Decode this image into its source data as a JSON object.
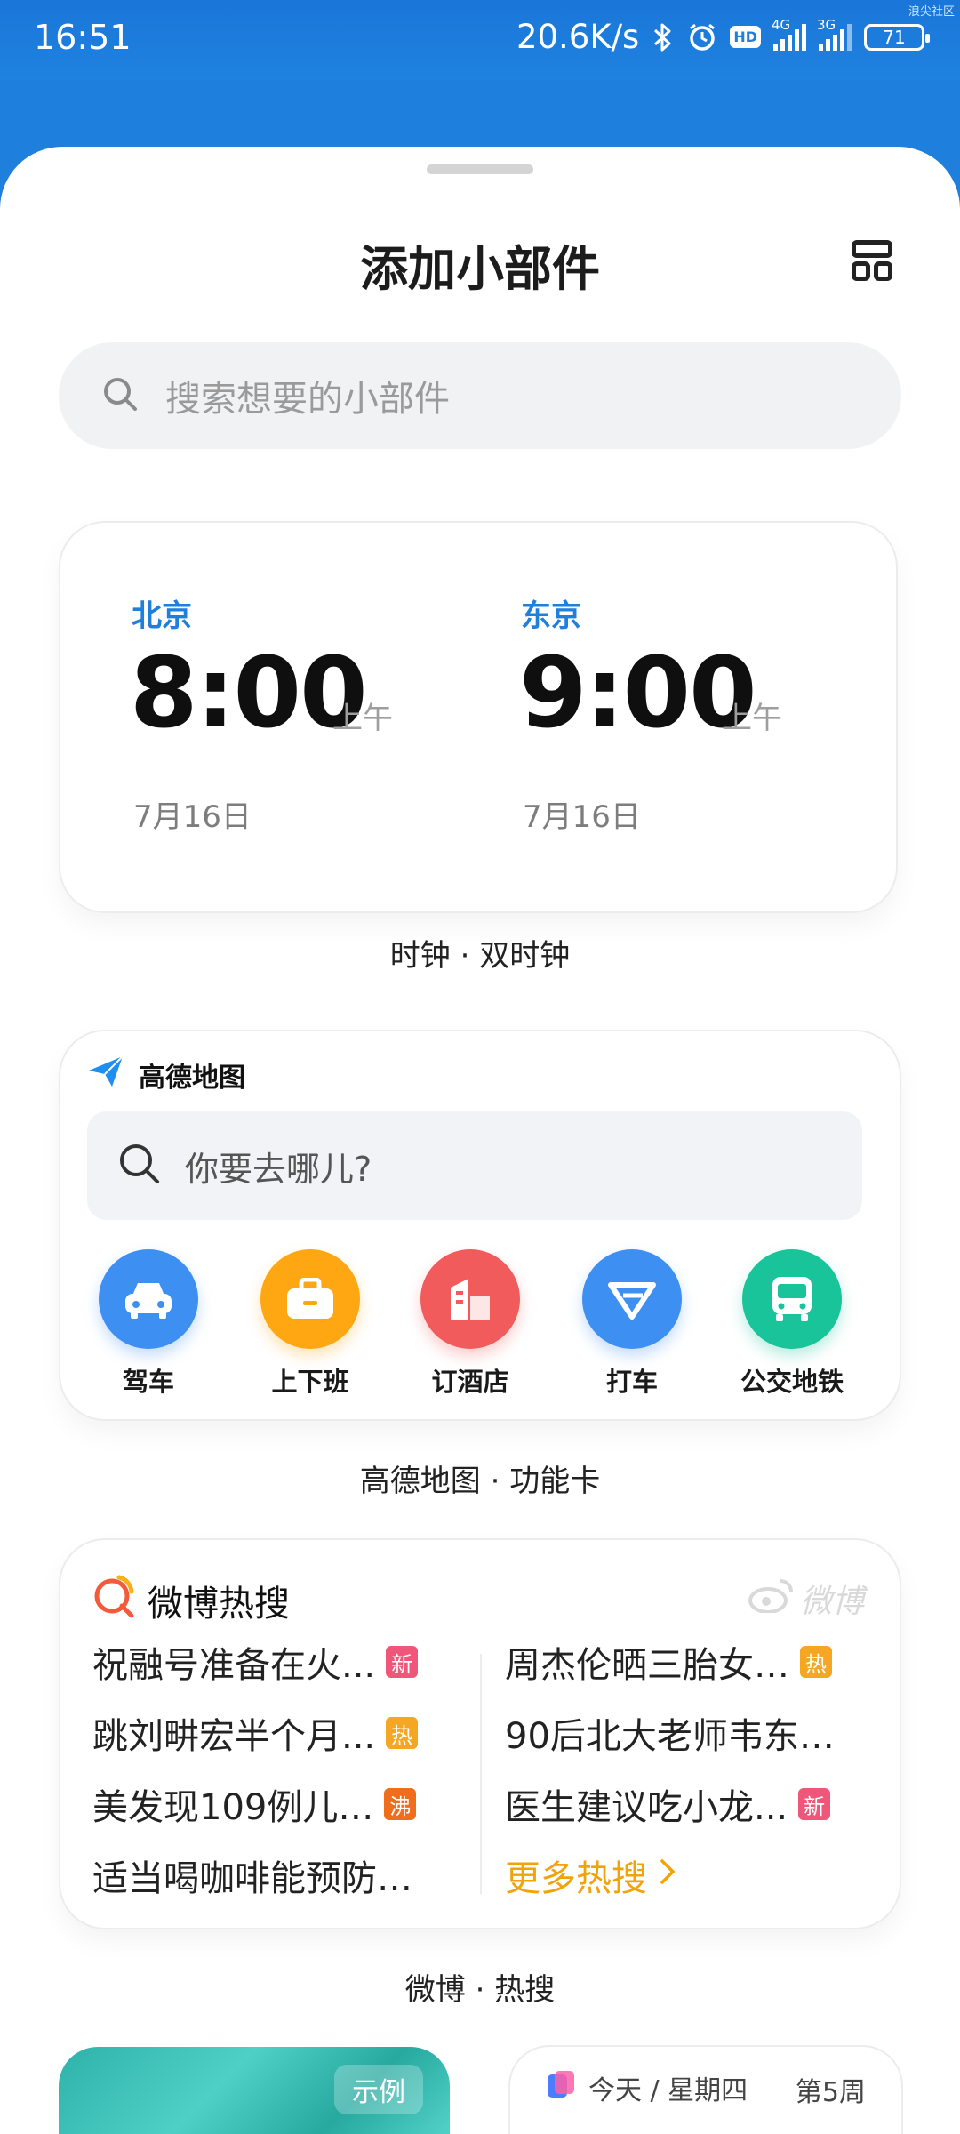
{
  "status_bar": {
    "time": "16:51",
    "speed": "20.6K/s",
    "hd": "HD",
    "net1": "4G",
    "net2": "3G",
    "battery": "71",
    "watermark": "浪尖社区"
  },
  "sheet": {
    "title": "添加小部件"
  },
  "search": {
    "placeholder": "搜索想要的小部件"
  },
  "clock_widget": {
    "cities": [
      {
        "name": "北京",
        "time": "8:00",
        "ampm": "上午",
        "date": "7月16日"
      },
      {
        "name": "东京",
        "time": "9:00",
        "ampm": "上午",
        "date": "7月16日"
      }
    ],
    "caption": "时钟 · 双时钟"
  },
  "amap_widget": {
    "app_name": "高德地图",
    "search_placeholder": "你要去哪儿?",
    "functions": [
      {
        "label": "驾车",
        "icon": "car-icon",
        "color": "#3e8ff2"
      },
      {
        "label": "上下班",
        "icon": "briefcase-icon",
        "color": "#ffa713"
      },
      {
        "label": "订酒店",
        "icon": "hotel-icon",
        "color": "#f15b5b"
      },
      {
        "label": "打车",
        "icon": "taxi-icon",
        "color": "#3e8ff2"
      },
      {
        "label": "公交地铁",
        "icon": "bus-icon",
        "color": "#19c49a"
      }
    ],
    "caption": "高德地图 · 功能卡"
  },
  "weibo_widget": {
    "title": "微博热搜",
    "brand": "微博",
    "left_items": [
      {
        "text": "祝融号准备在火...",
        "badge": "新",
        "type": "new"
      },
      {
        "text": "跳刘畊宏半个月...",
        "badge": "热",
        "type": "hot"
      },
      {
        "text": "美发现109例儿…",
        "badge": "沸",
        "type": "boil"
      },
      {
        "text": "适当喝咖啡能预防…",
        "badge": "",
        "type": ""
      }
    ],
    "right_items": [
      {
        "text": "周杰伦晒三胎女…",
        "badge": "热",
        "type": "hot"
      },
      {
        "text": "90后北大老师韦东…",
        "badge": "",
        "type": ""
      },
      {
        "text": "医生建议吃小龙...",
        "badge": "新",
        "type": "new"
      }
    ],
    "more": "更多热搜",
    "caption": "微博 · 热搜"
  },
  "photo_widget": {
    "tag": "示例"
  },
  "calendar_widget": {
    "today": "今天 / 星期四",
    "week": "第5周"
  }
}
